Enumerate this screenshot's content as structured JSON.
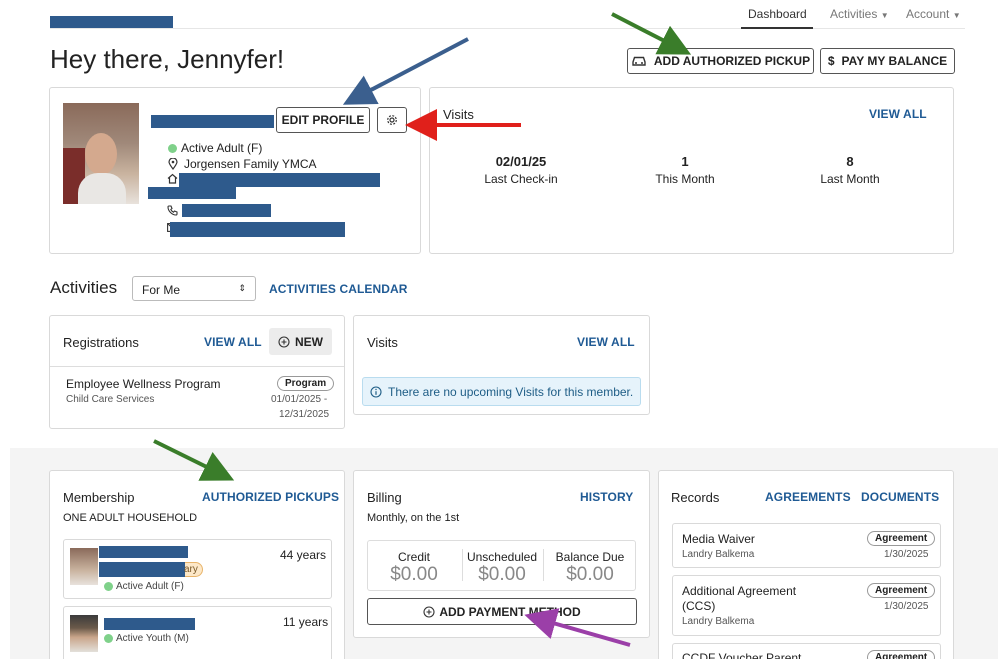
{
  "nav": {
    "dashboard": "Dashboard",
    "activities": "Activities",
    "account": "Account"
  },
  "header": {
    "greeting": "Hey there, Jennyfer!",
    "add_pickup_label": "ADD AUTHORIZED PICKUP",
    "pay_balance_label": "PAY MY BALANCE"
  },
  "profile": {
    "edit_label": "EDIT PROFILE",
    "membership_type": "Active Adult (F)",
    "location": "Jorgensen Family YMCA"
  },
  "visits_summary": {
    "title": "Visits",
    "view_all": "VIEW ALL",
    "stats": [
      {
        "value": "02/01/25",
        "label": "Last Check-in"
      },
      {
        "value": "1",
        "label": "This Month"
      },
      {
        "value": "8",
        "label": "Last Month"
      }
    ]
  },
  "activities": {
    "title": "Activities",
    "select_value": "For Me",
    "calendar_link": "ACTIVITIES CALENDAR"
  },
  "registrations": {
    "title": "Registrations",
    "view_all": "VIEW ALL",
    "new_label": "NEW",
    "item": {
      "name": "Employee Wellness Program",
      "category": "Child Care Services",
      "badge": "Program",
      "date_start": "01/01/2025 -",
      "date_end": "12/31/2025"
    }
  },
  "upcoming_visits": {
    "title": "Visits",
    "view_all": "VIEW ALL",
    "empty_message": "There are no upcoming Visits for this member."
  },
  "membership": {
    "title": "Membership",
    "pickups_link": "AUTHORIZED PICKUPS",
    "household": "ONE ADULT HOUSEHOLD",
    "members": [
      {
        "age": "44 years",
        "badge_fragment": "ary",
        "status": "Active Adult (F)"
      },
      {
        "age": "11 years",
        "status": "Active Youth (M)"
      }
    ]
  },
  "billing": {
    "title": "Billing",
    "history_link": "HISTORY",
    "schedule": "Monthly, on the 1st",
    "amounts": [
      {
        "label": "Credit",
        "value": "$0.00"
      },
      {
        "label": "Unscheduled",
        "value": "$0.00"
      },
      {
        "label": "Balance Due",
        "value": "$0.00"
      }
    ],
    "add_payment_label": "ADD PAYMENT METHOD"
  },
  "records": {
    "title": "Records",
    "agreements_link": "AGREEMENTS",
    "documents_link": "DOCUMENTS",
    "items": [
      {
        "name": "Media Waiver",
        "badge": "Agreement",
        "person": "Landry Balkema",
        "date": "1/30/2025"
      },
      {
        "name_line1": "Additional Agreement",
        "name_line2": "(CCS)",
        "badge": "Agreement",
        "person": "Landry Balkema",
        "date": "1/30/2025"
      },
      {
        "name": "CCDF Voucher Parent",
        "badge": "Agreement"
      }
    ]
  },
  "colors": {
    "link_blue": "#1f5a94",
    "redaction": "#2e5a8c",
    "status_green": "#7fd18a",
    "arrow_green": "#3a7d2a",
    "arrow_blue": "#3b5f8e",
    "arrow_red": "#e0201b",
    "arrow_purple": "#9b3fa8"
  }
}
